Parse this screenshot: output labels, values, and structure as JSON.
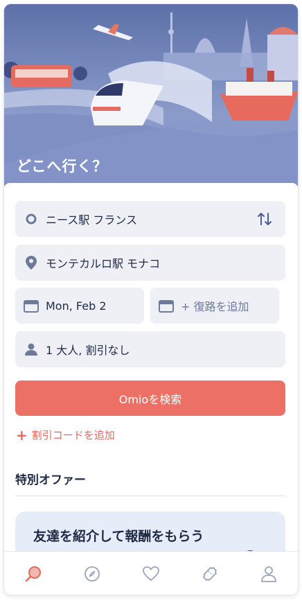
{
  "hero": {
    "title": "どこへ行く？"
  },
  "form": {
    "from": "ニース駅 フランス",
    "to": "モンテカルロ駅 モナコ",
    "depart_date": "Mon, Feb 2",
    "return_placeholder": "+ 復路を追加",
    "passengers": "1 大人, 割引なし",
    "search_label": "Omioを検索",
    "promo_code": "割引コードを追加"
  },
  "offers": {
    "section_title": "特別オファー",
    "card_title": "友達を紹介して報酬をもらう"
  },
  "nav": {
    "items": [
      "search-icon",
      "explore-icon",
      "favorites-icon",
      "tickets-icon",
      "account-icon"
    ],
    "active": "search-icon"
  },
  "colors": {
    "accent": "#ec7066",
    "field_bg": "#eef0f5",
    "text": "#1f2a44",
    "icon": "#6e7a99"
  }
}
